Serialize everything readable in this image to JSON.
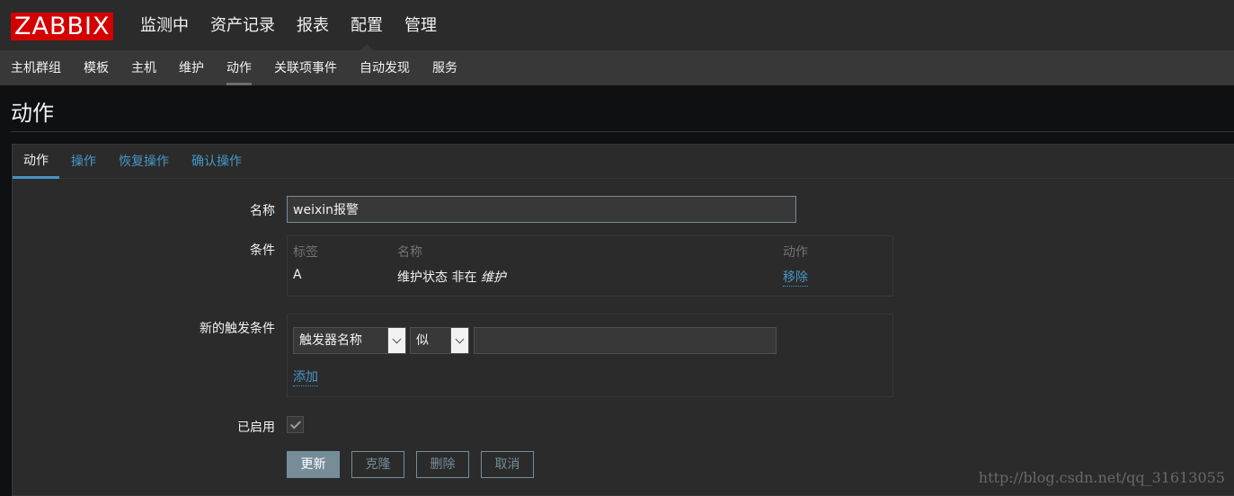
{
  "logo": "ZABBIX",
  "main_nav": [
    "监测中",
    "资产记录",
    "报表",
    "配置",
    "管理"
  ],
  "main_nav_active": "配置",
  "sub_nav": [
    "主机群组",
    "模板",
    "主机",
    "维护",
    "动作",
    "关联项事件",
    "自动发现",
    "服务"
  ],
  "sub_nav_active": "动作",
  "page_title": "动作",
  "tabs": [
    "动作",
    "操作",
    "恢复操作",
    "确认操作"
  ],
  "tab_active": "动作",
  "form": {
    "name_label": "名称",
    "name_value": "weixin报警",
    "conditions_label": "条件",
    "conditions_headers": {
      "tag": "标签",
      "name": "名称",
      "action": "动作"
    },
    "conditions_row": {
      "tag": "A",
      "name_prefix": "维护状态 非在 ",
      "name_emph": "维护",
      "action": "移除"
    },
    "new_condition_label": "新的触发条件",
    "new_condition_type": "触发器名称",
    "new_condition_operator": "似",
    "new_condition_value": "",
    "add_link": "添加",
    "enabled_label": "已启用",
    "enabled": true
  },
  "buttons": {
    "update": "更新",
    "clone": "克隆",
    "delete": "删除",
    "cancel": "取消"
  },
  "watermark": "http://blog.csdn.net/qq_31613055",
  "colors": {
    "accent": "#4796c4",
    "logo_bg": "#d40000",
    "button": "#768d99"
  }
}
